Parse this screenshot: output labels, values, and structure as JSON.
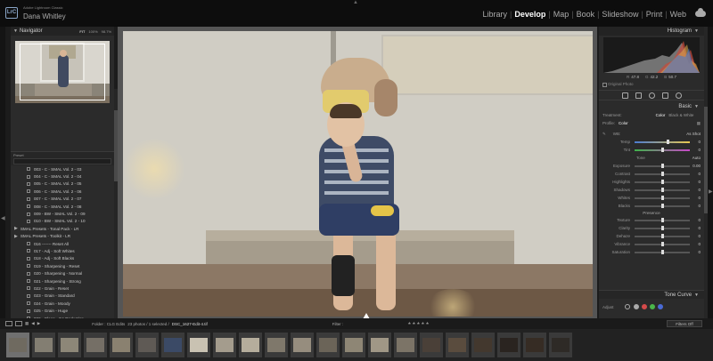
{
  "app": {
    "brand": "Adobe Lightroom Classic",
    "user": "Dana Whitley",
    "logo": "LrC"
  },
  "modules": [
    "Library",
    "Develop",
    "Map",
    "Book",
    "Slideshow",
    "Print",
    "Web"
  ],
  "active_module": "Develop",
  "navigator": {
    "title": "Navigator",
    "zoom": [
      "FIT",
      "100%",
      "98.7%"
    ]
  },
  "presets": {
    "label": "Preset",
    "items": [
      {
        "kind": "item",
        "label": "003 - C - SMAL Vol. 2 - 03"
      },
      {
        "kind": "item",
        "label": "004 - C - SMAL Vol. 2 - 04"
      },
      {
        "kind": "item",
        "label": "005 - C - SMAL Vol. 2 - 05"
      },
      {
        "kind": "item",
        "label": "006 - C - SMAL Vol. 2 - 06"
      },
      {
        "kind": "item",
        "label": "007 - C - SMAL Vol. 2 - 07"
      },
      {
        "kind": "item",
        "label": "008 - C - SMAL Vol. 2 - 08"
      },
      {
        "kind": "item",
        "label": "009 - BW - SMAL Vol. 2 - 09"
      },
      {
        "kind": "item",
        "label": "010 - BW - SMAL Vol. 2 - 10"
      },
      {
        "kind": "group",
        "label": "SMAL Presets - Tonal Pack - LR"
      },
      {
        "kind": "group",
        "label": "SMAL Presets - Toolkit - LR"
      },
      {
        "kind": "item",
        "label": "016 ------- Reset All"
      },
      {
        "kind": "item",
        "label": "017 - Adj - Soft Whites"
      },
      {
        "kind": "item",
        "label": "018 - Adj - Soft Blacks"
      },
      {
        "kind": "item",
        "label": "019 - Sharpening - Reset"
      },
      {
        "kind": "item",
        "label": "020 - Sharpening - Normal"
      },
      {
        "kind": "item",
        "label": "021 - Sharpening - Strong"
      },
      {
        "kind": "item",
        "label": "022 - Grain - Reset"
      },
      {
        "kind": "item",
        "label": "023 - Grain - Standard"
      },
      {
        "kind": "item",
        "label": "024 - Grain - Moody"
      },
      {
        "kind": "item",
        "label": "025 - Grain - Huge"
      },
      {
        "kind": "item",
        "label": "026 - Clean - CA Reduction"
      }
    ]
  },
  "right": {
    "histogram_title": "Histogram",
    "hist_values": [
      {
        "k": "R",
        "v": "47.8"
      },
      {
        "k": "G",
        "v": "42.2"
      },
      {
        "k": "B",
        "v": "50.7"
      }
    ],
    "original_photo": "Original Photo",
    "basic_title": "Basic",
    "treatment": {
      "label": "Treatment:",
      "color": "Color",
      "bw": "Black & White"
    },
    "profile": {
      "label": "Profile:",
      "value": "Color"
    },
    "wb": {
      "label": "WB:",
      "value": "As Shot"
    },
    "tone_label": "Tone",
    "tone_auto": "Auto",
    "presence_label": "Presence",
    "sliders": [
      {
        "label": "Temp",
        "value": "0",
        "pos": 0.6,
        "style": "grad-temp"
      },
      {
        "label": "Tint",
        "value": "0",
        "pos": 0.5,
        "style": "grad-tint"
      },
      {
        "label": "Exposure",
        "value": "0.00",
        "pos": 0.5
      },
      {
        "label": "Contrast",
        "value": "0",
        "pos": 0.5
      },
      {
        "label": "Highlights",
        "value": "0",
        "pos": 0.5
      },
      {
        "label": "Shadows",
        "value": "0",
        "pos": 0.5
      },
      {
        "label": "Whites",
        "value": "0",
        "pos": 0.5
      },
      {
        "label": "Blacks",
        "value": "0",
        "pos": 0.5
      },
      {
        "label": "Texture",
        "value": "0",
        "pos": 0.5
      },
      {
        "label": "Clarity",
        "value": "0",
        "pos": 0.5
      },
      {
        "label": "Dehaze",
        "value": "0",
        "pos": 0.5
      },
      {
        "label": "Vibrance",
        "value": "0",
        "pos": 0.5
      },
      {
        "label": "Saturation",
        "value": "0",
        "pos": 0.5
      }
    ],
    "tone_curve_title": "Tone Curve",
    "adjust_label": "Adjust",
    "dot_colors": [
      "#aaaaaa",
      "#d44a4a",
      "#4ab54a",
      "#4a6ad4"
    ]
  },
  "filmbar": {
    "folder": "Folder : CLG Edits",
    "count": "23 photos / 1 selected /",
    "file": "DSC_1627-Edit-4.tif",
    "filter": "Filter :",
    "stars": "★★★★★",
    "filters_off": "Filters Off"
  },
  "filmstrip": {
    "count": 22,
    "selected": 0
  },
  "colors": {
    "accent": "#ffffff",
    "panel": "#2b2b2b"
  }
}
